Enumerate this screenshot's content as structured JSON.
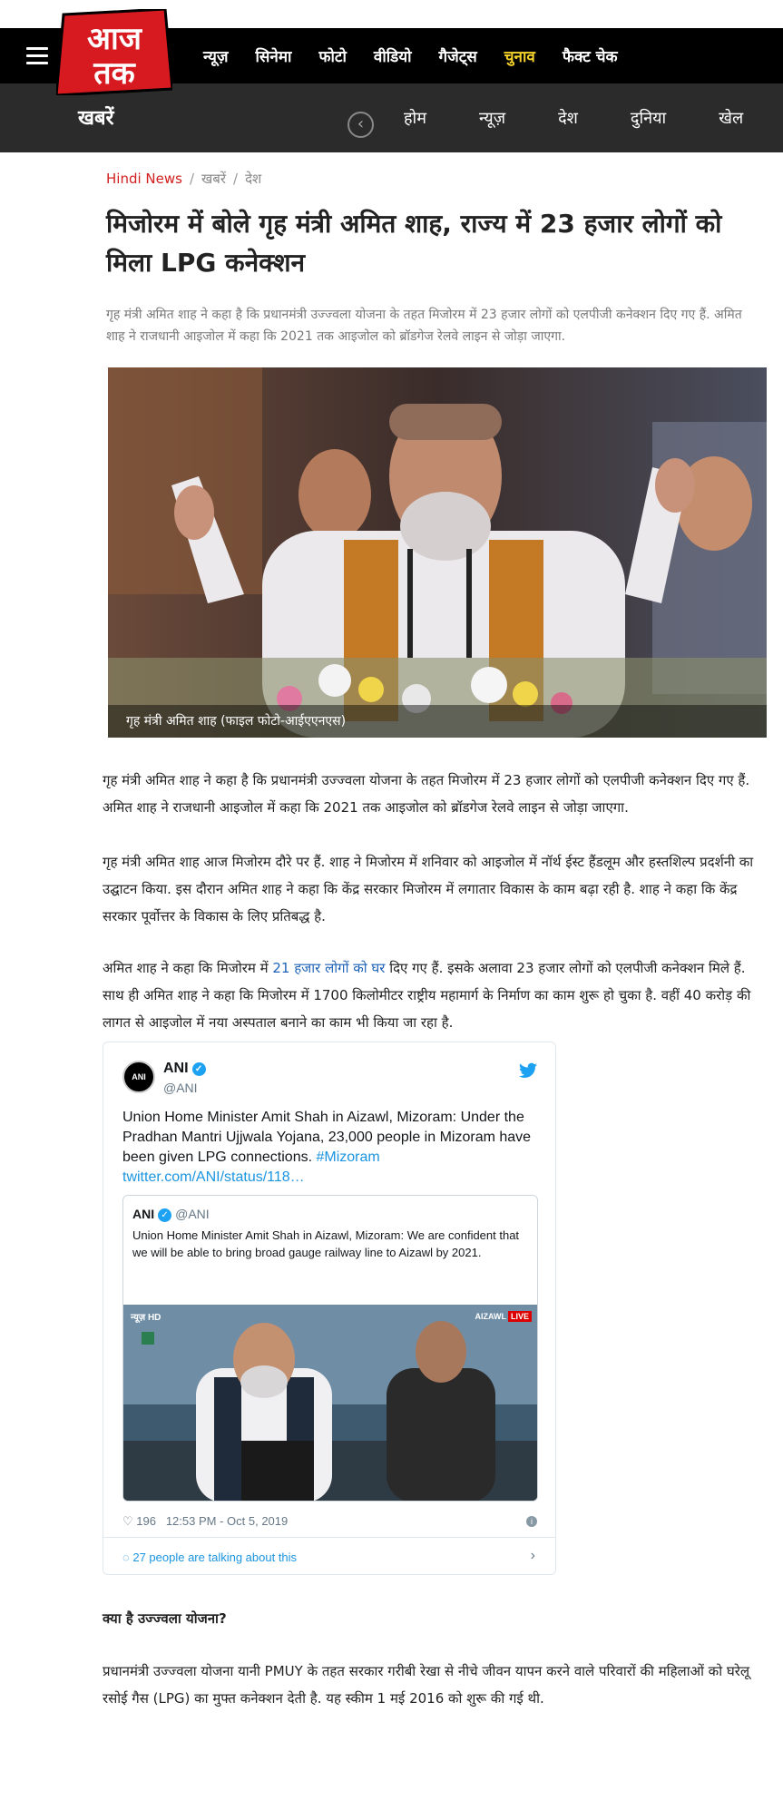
{
  "header": {
    "logo_text": "आज तक",
    "menu": [
      {
        "label": "न्यूज़",
        "active": false
      },
      {
        "label": "सिनेमा",
        "active": false
      },
      {
        "label": "फोटो",
        "active": false
      },
      {
        "label": "वीडियो",
        "active": false
      },
      {
        "label": "गैजेट्स",
        "active": false
      },
      {
        "label": "चुनाव",
        "active": true
      },
      {
        "label": "फैक्ट चेक",
        "active": false
      }
    ]
  },
  "subnav": {
    "section_title": "खबरें",
    "items": [
      "होम",
      "न्यूज़",
      "देश",
      "दुनिया",
      "खेल"
    ]
  },
  "breadcrumb": [
    "Hindi News",
    "खबरें",
    "देश"
  ],
  "article": {
    "headline": "मिजोरम में बोले गृह मंत्री अमित शाह, राज्य में 23 हजार लोगों को मिला LPG कनेक्शन",
    "summary": "गृह मंत्री अमित शाह ने कहा है कि प्रधानमंत्री उज्ज्वला योजना के तहत मिजोरम में 23 हजार लोगों को एलपीजी कनेक्शन दिए गए हैं. अमित शाह ने राजधानी आइजोल में कहा कि 2021 तक आइजोल को ब्रॉडगेज रेलवे लाइन से जोड़ा जाएगा.",
    "image_caption": "गृह मंत्री अमित शाह (फाइल फोटो-आईएएनएस)",
    "para1": "गृह मंत्री अमित शाह ने कहा है कि प्रधानमंत्री उज्ज्वला योजना के तहत मिजोरम में 23 हजार लोगों को एलपीजी कनेक्शन दिए गए हैं. अमित शाह ने राजधानी आइजोल में कहा कि 2021 तक आइजोल को ब्रॉडगेज रेलवे लाइन से जोड़ा जाएगा.",
    "para2": "गृह मंत्री अमित शाह आज मिजोरम दौरे पर हैं. शाह ने मिजोरम में शनिवार को आइजोल में नॉर्थ ईस्ट हैंडलूम और हस्तशिल्प प्रदर्शनी का उद्घाटन किया. इस दौरान अमित शाह ने कहा कि केंद्र सरकार मिजोरम में लगातार विकास के काम बढ़ा रही है. शाह ने कहा कि केंद्र सरकार पूर्वोत्तर के विकास के लिए प्रतिबद्ध है.",
    "para3_before": "अमित शाह ने कहा कि मिजोरम में ",
    "para3_link": "21 हजार लोगों को घर",
    "para3_after": " दिए गए हैं. इसके अलावा 23 हजार लोगों को एलपीजी कनेक्शन मिले हैं. साथ ही अमित शाह ने कहा कि मिजोरम में 1700 किलोमीटर राष्ट्रीय महामार्ग के निर्माण का काम शुरू हो चुका है. वहीं 40 करोड़ की लागत से आइजोल में नया अस्पताल बनाने का काम भी किया जा रहा है.",
    "subheading": "क्या है उज्ज्वला योजना?",
    "para4": "प्रधानमंत्री उज्ज्वला योजना यानी PMUY के तहत सरकार गरीबी रेखा से नीचे जीवन यापन करने वाले परिवारों की महिलाओं को घरेलू रसोई गैस (LPG) का मुफ्त कनेक्शन देती है. यह स्कीम 1 मई 2016 को शुरू की गई थी."
  },
  "tweet": {
    "avatar_text": "ANI",
    "name": "ANI",
    "handle": "@ANI",
    "text": "Union Home Minister Amit Shah in Aizawl, Mizoram: Under the Pradhan Mantri Ujjwala Yojana, 23,000 people in Mizoram have been given LPG connections. ",
    "hashtag": "#Mizoram",
    "link": "twitter.com/ANI/status/118…",
    "quoted": {
      "name": "ANI",
      "handle": "@ANI",
      "text": "Union Home Minister Amit Shah in Aizawl, Mizoram: We are confident that we will be able to bring broad gauge railway line to Aizawl by 2021.",
      "media_logo": "न्यूज़ HD",
      "media_location": "AIZAWL",
      "media_live": "LIVE"
    },
    "likes": "196",
    "timestamp": "12:53 PM - Oct 5, 2019",
    "talking": "27 people are talking about this"
  }
}
